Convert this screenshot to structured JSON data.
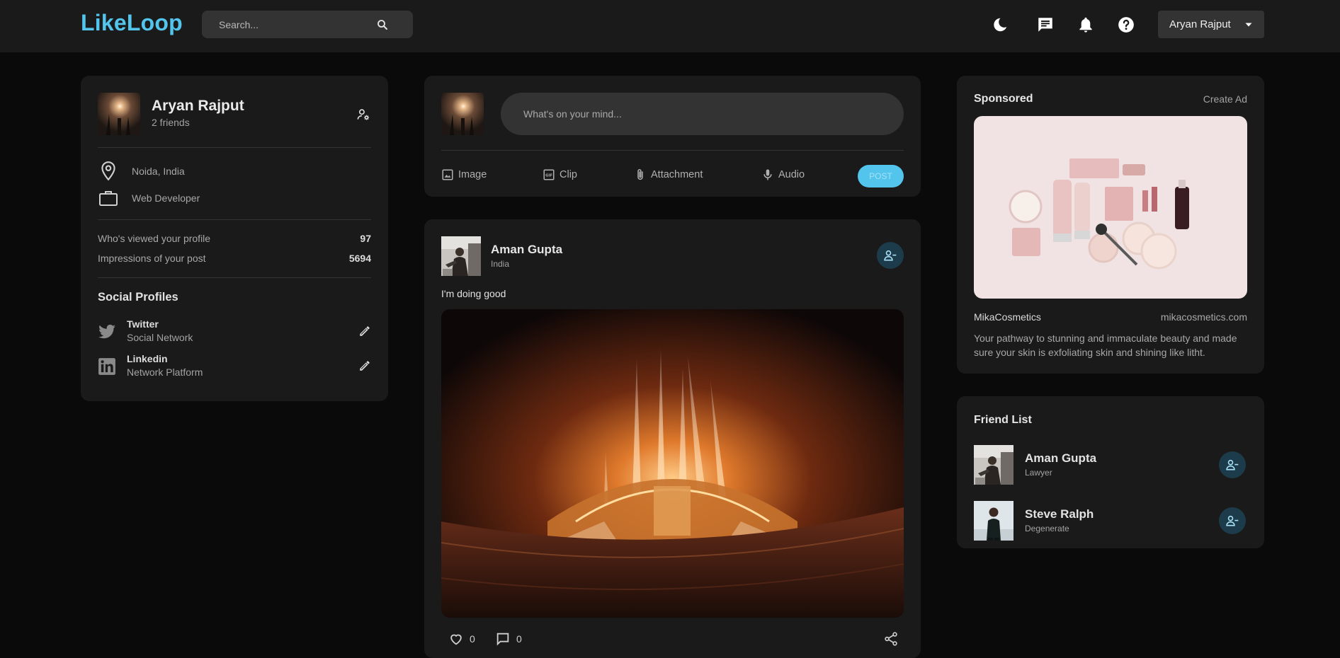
{
  "app": {
    "logo": "LikeLoop",
    "accent_color": "#53c4ec"
  },
  "navbar": {
    "search_placeholder": "Search...",
    "icons": [
      "moon-icon",
      "message-icon",
      "bell-icon",
      "help-icon"
    ],
    "user_name": "Aryan Rajput"
  },
  "profile": {
    "name": "Aryan Rajput",
    "friends": "2 friends",
    "location": "Noida, India",
    "occupation": "Web Developer",
    "stats": [
      {
        "label": "Who's viewed your profile",
        "value": "97"
      },
      {
        "label": "Impressions of your post",
        "value": "5694"
      }
    ],
    "social_title": "Social Profiles",
    "socials": [
      {
        "name": "Twitter",
        "sub": "Social Network",
        "icon": "twitter-icon"
      },
      {
        "name": "Linkedin",
        "sub": "Network Platform",
        "icon": "linkedin-icon"
      }
    ]
  },
  "composer": {
    "placeholder": "What's on your mind...",
    "actions": [
      {
        "label": "Image",
        "icon": "image-icon"
      },
      {
        "label": "Clip",
        "icon": "gif-icon"
      },
      {
        "label": "Attachment",
        "icon": "paperclip-icon"
      },
      {
        "label": "Audio",
        "icon": "microphone-icon"
      }
    ],
    "post_label": "POST"
  },
  "post": {
    "author": "Aman Gupta",
    "location": "India",
    "text": "I'm doing good",
    "likes": "0",
    "comments": "0"
  },
  "sponsored": {
    "title": "Sponsored",
    "create": "Create Ad",
    "brand": "MikaCosmetics",
    "url": "mikacosmetics.com",
    "description": "Your pathway to stunning and immaculate beauty and made sure your skin is exfoliating skin and shining like litht."
  },
  "friend_list": {
    "title": "Friend List",
    "friends": [
      {
        "name": "Aman Gupta",
        "occupation": "Lawyer"
      },
      {
        "name": "Steve Ralph",
        "occupation": "Degenerate"
      }
    ]
  }
}
